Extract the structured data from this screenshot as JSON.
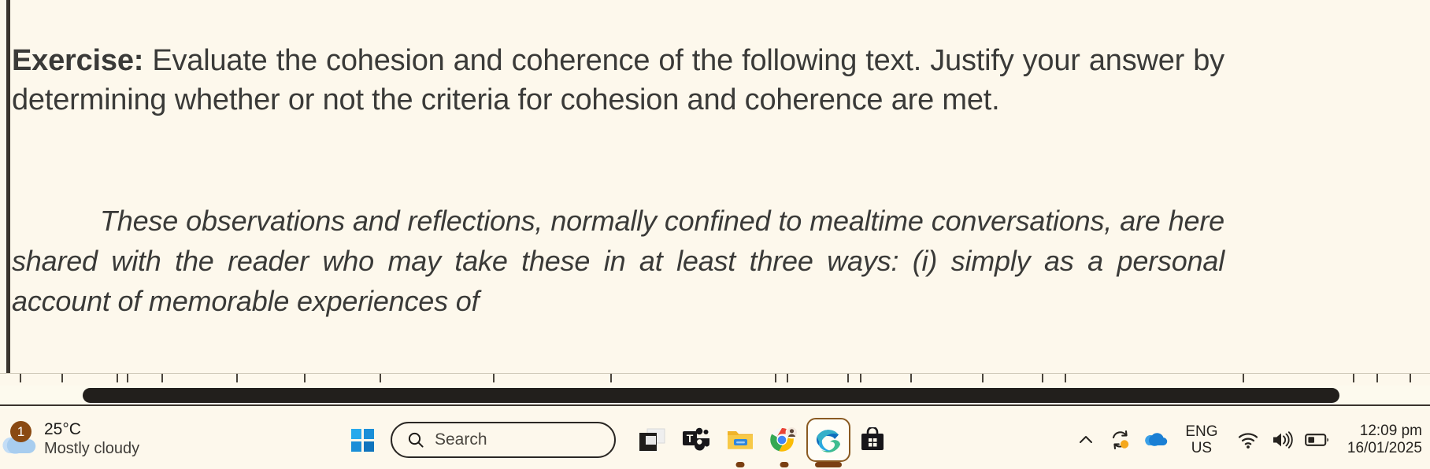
{
  "document": {
    "exercise_label": "Exercise:",
    "exercise_text": " Evaluate the cohesion and coherence of the following text. Justify your answer by determining whether or not the criteria for cohesion and coherence are met.",
    "quote_text": "These observations and reflections, normally confined to mealtime conversations, are here shared with the reader who may take these in at least three ways: (i) simply as a personal account of memorable experiences of"
  },
  "scrollbar": {
    "orientation": "horizontal",
    "thumb_label": "horizontal-scroll-thumb"
  },
  "taskbar": {
    "weather": {
      "temperature": "25°C",
      "condition": "Mostly cloudy",
      "badge_count": "1",
      "icon": "cloud-icon"
    },
    "start": {
      "label": "Start",
      "icon": "windows-logo-icon"
    },
    "search": {
      "placeholder": "Search",
      "icon": "search-icon"
    },
    "apps": [
      {
        "name": "task-view",
        "label": "Task View",
        "icon": "task-view-icon",
        "running": false,
        "active": false
      },
      {
        "name": "microsoft-teams",
        "label": "Microsoft Teams",
        "icon": "teams-icon",
        "running": false,
        "active": false
      },
      {
        "name": "file-explorer",
        "label": "File Explorer",
        "icon": "folder-icon",
        "running": true,
        "active": false
      },
      {
        "name": "google-chrome",
        "label": "Google Chrome",
        "icon": "chrome-icon",
        "running": true,
        "active": false
      },
      {
        "name": "microsoft-edge",
        "label": "Microsoft Edge",
        "icon": "edge-icon",
        "running": true,
        "active": true
      },
      {
        "name": "microsoft-store",
        "label": "Microsoft Store",
        "icon": "store-icon",
        "running": false,
        "active": false
      }
    ],
    "tray": {
      "overflow": {
        "label": "Show hidden icons",
        "icon": "chevron-up-icon"
      },
      "sync": {
        "label": "Sync status",
        "icon": "sync-icon"
      },
      "onedrive": {
        "label": "OneDrive",
        "icon": "onedrive-cloud-icon"
      },
      "language": {
        "line1": "ENG",
        "line2": "US"
      },
      "wifi": {
        "label": "Network",
        "icon": "wifi-icon"
      },
      "volume": {
        "label": "Volume",
        "icon": "speaker-icon"
      },
      "battery": {
        "label": "Battery",
        "icon": "battery-icon"
      },
      "clock": {
        "time": "12:09 pm",
        "date": "16/01/2025"
      }
    }
  },
  "colors": {
    "page_bg": "#fdf8ec",
    "taskbar_bg": "#fdf8ec",
    "text": "#3a3a38",
    "accent_active": "#8a5a22",
    "scrollbar_thumb": "#221f1c"
  }
}
